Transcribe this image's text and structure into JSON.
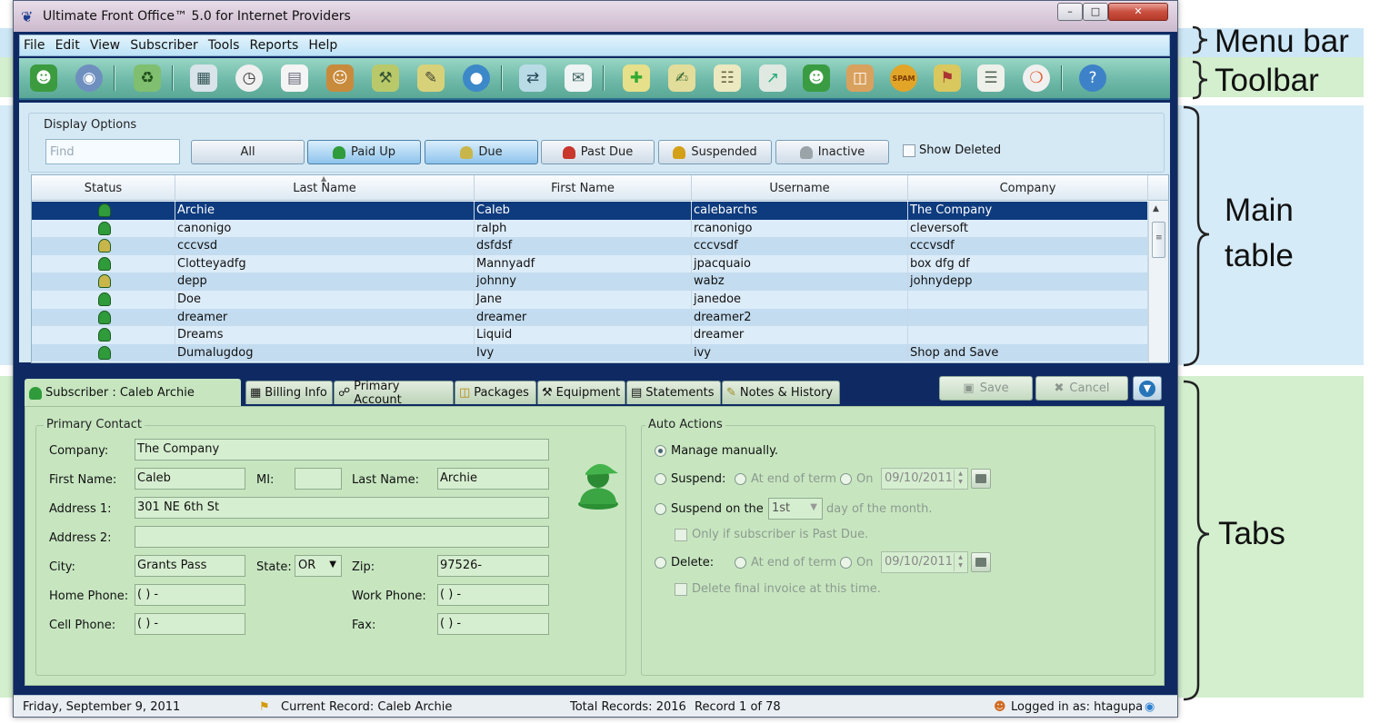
{
  "window": {
    "title": "Ultimate Front Office™ 5.0 for Internet Providers",
    "minimize_label": "–",
    "maximize_label": "□",
    "close_label": "✕"
  },
  "menu": [
    "File",
    "Edit",
    "View",
    "Subscriber",
    "Tools",
    "Reports",
    "Help"
  ],
  "toolbar": {
    "icons": [
      "add-subscriber-icon",
      "globe-icon",
      "recycle-bin-icon",
      "calculator-icon",
      "clock-icon",
      "document-icon",
      "users-icon",
      "tools-icon",
      "edit-note-icon",
      "world-icon",
      "transfer-icon",
      "email-icon",
      "new-note-icon",
      "add-note-icon",
      "report-icon",
      "chart-icon",
      "user-icon",
      "package-icon",
      "spam-icon",
      "map-icon",
      "list-icon",
      "lifebuoy-icon",
      "help-icon"
    ],
    "spam_text": "SPAM"
  },
  "display_options": {
    "label": "Display Options",
    "find_placeholder": "Find",
    "filters": [
      {
        "label": "All",
        "active": false
      },
      {
        "label": "Paid Up",
        "active": true
      },
      {
        "label": "Due",
        "active": true
      },
      {
        "label": "Past Due",
        "active": false
      },
      {
        "label": "Suspended",
        "active": false
      },
      {
        "label": "Inactive",
        "active": false
      }
    ],
    "show_deleted": "Show Deleted"
  },
  "table": {
    "columns": [
      "Status",
      "Last Name",
      "First Name",
      "Username",
      "Company"
    ],
    "rows": [
      [
        "Archie",
        "Caleb",
        "calebarchs",
        "The Company"
      ],
      [
        "canonigo",
        "ralph",
        "rcanonigo",
        "cleversoft"
      ],
      [
        "cccvsd",
        "dsfdsf",
        "cccvsdf",
        "cccvsdf"
      ],
      [
        "Clotteyadfg",
        "Mannyadf",
        "jpacquaio",
        " box dfg df"
      ],
      [
        "depp",
        "johnny",
        "wabz",
        "johnydepp"
      ],
      [
        "Doe",
        "Jane",
        "janedoe",
        ""
      ],
      [
        "dreamer",
        "dreamer",
        "dreamer2",
        ""
      ],
      [
        "Dreams",
        "Liquid",
        "dreamer",
        ""
      ],
      [
        "Dumalugdog",
        "Ivy",
        "ivy",
        "Shop and Save"
      ]
    ]
  },
  "tabs": {
    "items": [
      {
        "label": "Subscriber : Caleb Archie",
        "icon": "user-icon"
      },
      {
        "label": "Billing Info",
        "icon": "money-icon"
      },
      {
        "label": "Primary Account",
        "icon": "satellite-icon"
      },
      {
        "label": "Packages",
        "icon": "package-icon"
      },
      {
        "label": "Equipment",
        "icon": "tools-icon"
      },
      {
        "label": "Statements",
        "icon": "statement-icon"
      },
      {
        "label": "Notes & History",
        "icon": "notes-icon"
      }
    ],
    "save_label": "Save",
    "cancel_label": "Cancel"
  },
  "primary_contact": {
    "label": "Primary Contact",
    "company_label": "Company:",
    "company": "The Company",
    "first_name_label": "First Name:",
    "first_name": "Caleb",
    "mi_label": "MI:",
    "mi": "",
    "last_name_label": "Last Name:",
    "last_name": "Archie",
    "address1_label": "Address 1:",
    "address1": "301 NE 6th St",
    "address2_label": "Address 2:",
    "address2": "",
    "city_label": "City:",
    "city": "Grants Pass",
    "state_label": "State:",
    "state": "OR",
    "zip_label": "Zip:",
    "zip": "97526-",
    "home_phone_label": "Home Phone:",
    "home_phone": "(  )   -",
    "work_phone_label": "Work Phone:",
    "work_phone": "(  )   -",
    "cell_phone_label": "Cell Phone:",
    "cell_phone": "(  )   -",
    "fax_label": "Fax:",
    "fax": "(  )   -"
  },
  "auto_actions": {
    "label": "Auto Actions",
    "manage_manually": "Manage manually.",
    "suspend": "Suspend:",
    "at_end_of_term": "At end of term",
    "on": "On",
    "suspend_date": "09/10/2011",
    "suspend_on_the": "Suspend on the",
    "day_value": "1st",
    "day_of_month": "day of the month.",
    "only_if_past_due": "Only if subscriber is Past Due.",
    "delete": "Delete:",
    "delete_date": "09/10/2011",
    "delete_final_invoice": "Delete final invoice at this time."
  },
  "status_bar": {
    "date": "Friday, September 9, 2011",
    "current_record": "Current Record: Caleb Archie",
    "total_records": "Total Records: 2016",
    "record_position": "Record 1 of 78",
    "logged_in": "Logged in as: htagupa"
  },
  "annotations": {
    "menu_bar": "Menu bar",
    "toolbar": "Toolbar",
    "main_table_line1": "Main",
    "main_table_line2": "table",
    "tabs": "Tabs"
  },
  "colors": {
    "selected_row": "#0e3b7e",
    "toolbar_band": "#d3efce",
    "menu_band": "#cde7f7",
    "tab_panel": "#c7e6c0",
    "window_frame": "#0f2a63"
  }
}
